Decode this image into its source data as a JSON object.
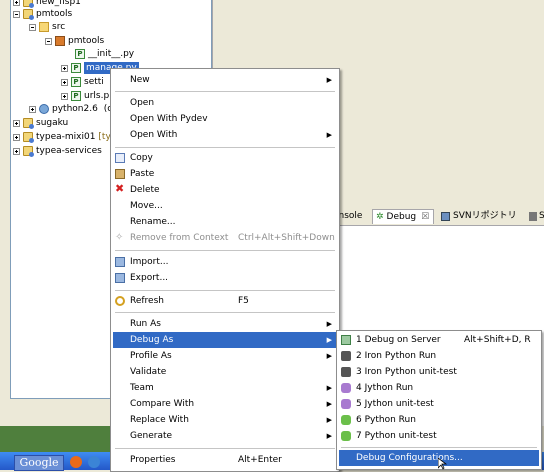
{
  "tree": {
    "rows": [
      {
        "label": "new_fisp1",
        "indent": 0
      },
      {
        "label": "pmtools",
        "indent": 0
      },
      {
        "label": "src",
        "indent": 1
      },
      {
        "label": "pmtools",
        "indent": 2
      },
      {
        "label": "__init__.py",
        "indent": 3
      },
      {
        "label": "manage.py",
        "indent": 3
      },
      {
        "label": "setti",
        "indent": 3
      },
      {
        "label": "urls.p",
        "indent": 3
      },
      {
        "label": "python2.6",
        "indent": 1
      },
      {
        "label": "sugaku",
        "indent": 0
      },
      {
        "label": "typea-mixi01",
        "indent": 0
      },
      {
        "label": "typea-services",
        "indent": 0
      }
    ],
    "python_suffix": "(c",
    "mixi_suffix": "[ty"
  },
  "tabs": {
    "console_label": "onsole",
    "debug_label": "Debug",
    "debug_close": "☒",
    "svn_label": "SVNリポジトリ",
    "other_label": "S"
  },
  "taskbar": {
    "google_label": "Google"
  },
  "context_menu": {
    "new": "New",
    "open": "Open",
    "open_pydev": "Open With Pydev",
    "open_with": "Open With",
    "copy": "Copy",
    "paste": "Paste",
    "delete": "Delete",
    "move": "Move...",
    "rename": "Rename...",
    "remove_context": "Remove from Context",
    "remove_context_shortcut": "Ctrl+Alt+Shift+Down",
    "import": "Import...",
    "export": "Export...",
    "refresh": "Refresh",
    "refresh_shortcut": "F5",
    "run_as": "Run As",
    "debug_as": "Debug As",
    "profile_as": "Profile As",
    "validate": "Validate",
    "team": "Team",
    "compare_with": "Compare With",
    "replace_with": "Replace With",
    "generate": "Generate",
    "properties": "Properties",
    "properties_shortcut": "Alt+Enter"
  },
  "submenu": {
    "items": [
      {
        "label": "1 Debug on Server",
        "shortcut": "Alt+Shift+D, R"
      },
      {
        "label": "2 Iron Python Run",
        "shortcut": ""
      },
      {
        "label": "3 Iron Python unit-test",
        "shortcut": ""
      },
      {
        "label": "4 Jython Run",
        "shortcut": ""
      },
      {
        "label": "5 Jython unit-test",
        "shortcut": ""
      },
      {
        "label": "6 Python Run",
        "shortcut": ""
      },
      {
        "label": "7 Python unit-test",
        "shortcut": ""
      }
    ],
    "debug_configurations": "Debug Configurations..."
  },
  "colors": {
    "highlight": "#316ac5",
    "menu_bg": "#ffffff",
    "chrome": "#ece9d8"
  }
}
